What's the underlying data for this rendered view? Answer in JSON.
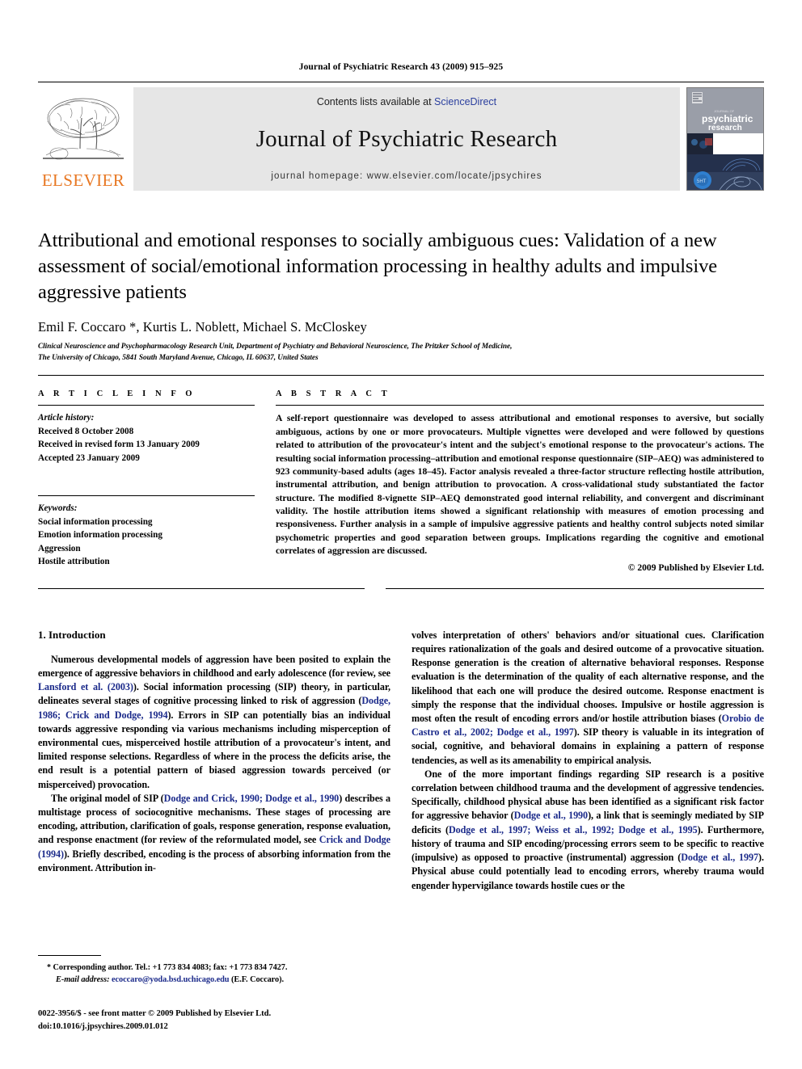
{
  "running_head": "Journal of Psychiatric Research 43 (2009) 915–925",
  "masthead": {
    "publisher_logo_text": "ELSEVIER",
    "contents_prefix": "Contents lists available at ",
    "contents_link": "ScienceDirect",
    "journal_name": "Journal of Psychiatric Research",
    "homepage": "journal homepage: www.elsevier.com/locate/jpsychires",
    "cover_title_line1": "psychiatric",
    "cover_title_line2": "research",
    "cover_kicker": "JOURNAL OF"
  },
  "article": {
    "title": "Attributional and emotional responses to socially ambiguous cues: Validation of a new assessment of social/emotional information processing in healthy adults and impulsive aggressive patients",
    "authors": "Emil F. Coccaro *, Kurtis L. Noblett, Michael S. McCloskey",
    "affiliation_line1": "Clinical Neuroscience and Psychopharmacology Research Unit, Department of Psychiatry and Behavioral Neuroscience, The Pritzker School of Medicine,",
    "affiliation_line2": "The University of Chicago, 5841 South Maryland Avenue, Chicago, IL 60637, United States"
  },
  "article_info": {
    "heading": "A R T I C L E   I N F O",
    "history_label": "Article history:",
    "history": [
      "Received 8 October 2008",
      "Received in revised form 13 January 2009",
      "Accepted 23 January 2009"
    ],
    "keywords_label": "Keywords:",
    "keywords": [
      "Social information processing",
      "Emotion information processing",
      "Aggression",
      "Hostile attribution"
    ]
  },
  "abstract": {
    "heading": "A B S T R A C T",
    "text": "A self-report questionnaire was developed to assess attributional and emotional responses to aversive, but socially ambiguous, actions by one or more provocateurs. Multiple vignettes were developed and were followed by questions related to attribution of the provocateur's intent and the subject's emotional response to the provocateur's actions. The resulting social information processing–attribution and emotional response questionnaire (SIP–AEQ) was administered to 923 community-based adults (ages 18–45). Factor analysis revealed a three-factor structure reflecting hostile attribution, instrumental attribution, and benign attribution to provocation. A cross-validational study substantiated the factor structure. The modified 8-vignette SIP–AEQ demonstrated good internal reliability, and convergent and discriminant validity. The hostile attribution items showed a significant relationship with measures of emotion processing and responsiveness. Further analysis in a sample of impulsive aggressive patients and healthy control subjects noted similar psychometric properties and good separation between groups. Implications regarding the cognitive and emotional correlates of aggression are discussed.",
    "copyright": "© 2009 Published by Elsevier Ltd."
  },
  "body": {
    "section_heading": "1. Introduction",
    "left_p1_a": "Numerous developmental models of aggression have been posited to explain the emergence of aggressive behaviors in childhood and early adolescence (for review, see ",
    "left_p1_ref1": "Lansford et al. (2003)",
    "left_p1_b": "). Social information processing (SIP) theory, in particular, delineates several stages of cognitive processing linked to risk of aggression (",
    "left_p1_ref2": "Dodge, 1986; Crick and Dodge, 1994",
    "left_p1_c": "). Errors in SIP can potentially bias an individual towards aggressive responding via various mechanisms including misperception of environmental cues, misperceived hostile attribution of a provocateur's intent, and limited response selections. Regardless of where in the process the deficits arise, the end result is a potential pattern of biased aggression towards perceived (or misperceived) provocation.",
    "left_p2_a": "The original model of SIP (",
    "left_p2_ref1": "Dodge and Crick, 1990; Dodge et al., 1990",
    "left_p2_b": ") describes a multistage process of sociocognitive mechanisms. These stages of processing are encoding, attribution, clarification of goals, response generation, response evaluation, and response enactment (for review of the reformulated model, see ",
    "left_p2_ref2": "Crick and Dodge (1994)",
    "left_p2_c": "). Briefly described, encoding is the process of absorbing information from the environment. Attribution in-",
    "right_p1_a": "volves interpretation of others' behaviors and/or situational cues. Clarification requires rationalization of the goals and desired outcome of a provocative situation. Response generation is the creation of alternative behavioral responses. Response evaluation is the determination of the quality of each alternative response, and the likelihood that each one will produce the desired outcome. Response enactment is simply the response that the individual chooses. Impulsive or hostile aggression is most often the result of encoding errors and/or hostile attribution biases (",
    "right_p1_ref1": "Orobio de Castro et al., 2002; Dodge et al., 1997",
    "right_p1_b": "). SIP theory is valuable in its integration of social, cognitive, and behavioral domains in explaining a pattern of response tendencies, as well as its amenability to empirical analysis.",
    "right_p2_a": "One of the more important findings regarding SIP research is a positive correlation between childhood trauma and the development of aggressive tendencies. Specifically, childhood physical abuse has been identified as a significant risk factor for aggressive behavior (",
    "right_p2_ref1": "Dodge et al., 1990",
    "right_p2_b": "), a link that is seemingly mediated by SIP deficits (",
    "right_p2_ref2": "Dodge et al., 1997; Weiss et al., 1992; Dodge et al., 1995",
    "right_p2_c": "). Furthermore, history of trauma and SIP encoding/processing errors seem to be specific to reactive (impulsive) as opposed to proactive (instrumental) aggression (",
    "right_p2_ref3": "Dodge et al., 1997",
    "right_p2_d": "). Physical abuse could potentially lead to encoding errors, whereby trauma would engender hypervigilance towards hostile cues or the"
  },
  "footnote": {
    "marker": "*",
    "corresponding": "Corresponding author. Tel.: +1 773 834 4083; fax: +1 773 834 7427.",
    "email_label": "E-mail address:",
    "email": "ecoccaro@yoda.bsd.uchicago.edu",
    "email_owner": "(E.F. Coccaro).",
    "issn_line": "0022-3956/$ - see front matter © 2009 Published by Elsevier Ltd.",
    "doi_line": "doi:10.1016/j.jpsychires.2009.01.012"
  },
  "colors": {
    "link": "#1B2A8A",
    "elsevier_orange": "#E87722",
    "band_gray": "#E6E6E6"
  }
}
